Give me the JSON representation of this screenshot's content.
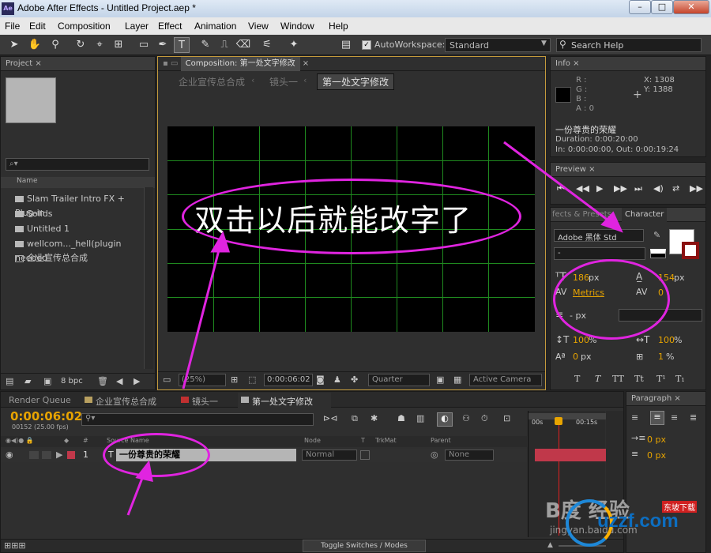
{
  "window": {
    "title": "Adobe After Effects - Untitled Project.aep *",
    "app_icon": "Ae",
    "controls": [
      "minimize",
      "maximize",
      "close"
    ]
  },
  "menu": [
    "File",
    "Edit",
    "Composition",
    "Layer",
    "Effect",
    "Animation",
    "View",
    "Window",
    "Help"
  ],
  "toolbar": {
    "autoworkspace_label": "AutoWorkspace:",
    "workspace_value": "Standard",
    "search_placeholder": "Search Help"
  },
  "project": {
    "tab": "Project",
    "search_placeholder": "⌕▾",
    "col_name": "Name",
    "items": [
      {
        "label": "Slam Trailer Intro FX + Plug-in",
        "type": "folder"
      },
      {
        "label": "Solids",
        "type": "folder"
      },
      {
        "label": "Untitled 1",
        "type": "folder"
      },
      {
        "label": "wellcom..._hell(plugin needed",
        "type": "folder"
      },
      {
        "label": "企业宣传总合成",
        "type": "comp"
      }
    ],
    "bpc": "8 bpc"
  },
  "composition": {
    "tab": "Composition: 第一处文字修改",
    "breadcrumbs": [
      "企业宣传总合成",
      "镜头一",
      "第一处文字修改"
    ],
    "canvas_text": "双击以后就能改字了",
    "zoom": "(25%)",
    "timecode": "0:00:06:02",
    "resolution": "Quarter",
    "camera": "Active Camera"
  },
  "info": {
    "tab": "Info",
    "r": "R :",
    "g": "G :",
    "b": "B :",
    "a": "A : 0",
    "x": "X: 1308",
    "y": "Y: 1388",
    "layer_name": "一份尊贵的荣耀",
    "duration": "Duration: 0:00:20:00",
    "in_out": "In: 0:00:00:00, Out: 0:00:19:24"
  },
  "preview": {
    "tab": "Preview"
  },
  "character": {
    "tabs": [
      "fects & Presets",
      "Character"
    ],
    "font": "Adobe 黑体 Std",
    "style": "-",
    "font_size": "186",
    "leading": "154",
    "unit": "px",
    "kerning": "Metrics",
    "tracking": "0",
    "stroke_px": "- px",
    "vscale": "100",
    "hscale": "100",
    "baseline": "0",
    "tsume": "1",
    "percent": "%",
    "style_buttons": [
      "T",
      "T",
      "TT",
      "Tt",
      "T¹",
      "T₁"
    ]
  },
  "timeline": {
    "tabs": [
      "Render Queue",
      "企业宣传总合成",
      "镜头一",
      "第一处文字修改"
    ],
    "timecode": "0:00:06:02",
    "fps": "00152 (25.00 fps)",
    "columns": [
      "#",
      "Source Name",
      "Node",
      "T",
      "TrkMat",
      "Parent"
    ],
    "layers": [
      {
        "num": "1",
        "type": "T",
        "name": "一份尊贵的荣耀",
        "mode": "Normal",
        "parent": "None"
      }
    ],
    "ruler": [
      "00s",
      "00:15s"
    ],
    "toggle_label": "Toggle Switches / Modes"
  },
  "paragraph": {
    "tab": "Paragraph",
    "indent": "0 px",
    "space": "0 px"
  },
  "watermark": {
    "baidu": "B度 经验",
    "site": "jingyan.baidu.com",
    "brand": "uzzf.com",
    "brand_sub": "东坡下载"
  },
  "colors": {
    "annotation": "#e024e0",
    "timecode": "#e8a400",
    "grid": "#1f8a1f",
    "bar": "#c0384a"
  }
}
